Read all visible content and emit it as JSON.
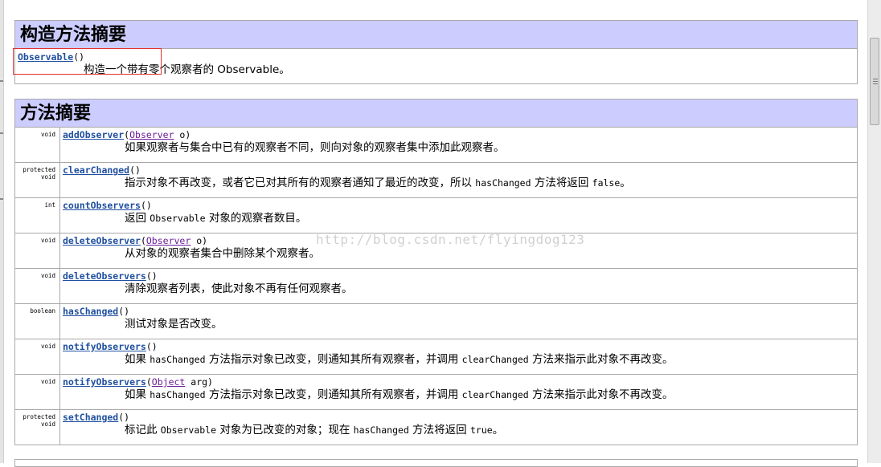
{
  "constructor_summary": {
    "title": "构造方法摘要",
    "constructor": {
      "name": "Observable",
      "params": "()",
      "description": "构造一个带有零个观察者的 Observable。"
    }
  },
  "method_summary": {
    "title": "方法摘要",
    "methods": [
      {
        "modifier_line1": "void",
        "modifier_line2": "",
        "name": "addObserver",
        "sig_open": "(",
        "param_type": "Observer",
        "sig_rest": " o)",
        "desc": [
          {
            "t": "如果观察者与集合中已有的观察者不同，则向对象的观察者集中添加此观察者。"
          }
        ]
      },
      {
        "modifier_line1": "protected",
        "modifier_line2": "void",
        "name": "clearChanged",
        "sig_open": "()",
        "param_type": "",
        "sig_rest": "",
        "desc": [
          {
            "t": "指示对象不再改变，或者它已对其所有的观察者通知了最近的改变，所以 "
          },
          {
            "c": "hasChanged"
          },
          {
            "t": " 方法将返回 "
          },
          {
            "c": "false"
          },
          {
            "t": "。"
          }
        ]
      },
      {
        "modifier_line1": "int",
        "modifier_line2": "",
        "name": "countObservers",
        "sig_open": "()",
        "param_type": "",
        "sig_rest": "",
        "desc": [
          {
            "t": "返回 "
          },
          {
            "c": "Observable"
          },
          {
            "t": " 对象的观察者数目。"
          }
        ]
      },
      {
        "modifier_line1": "void",
        "modifier_line2": "",
        "name": "deleteObserver",
        "sig_open": "(",
        "param_type": "Observer",
        "sig_rest": " o)",
        "desc": [
          {
            "t": "从对象的观察者集合中删除某个观察者。"
          }
        ]
      },
      {
        "modifier_line1": "void",
        "modifier_line2": "",
        "name": "deleteObservers",
        "sig_open": "()",
        "param_type": "",
        "sig_rest": "",
        "desc": [
          {
            "t": "清除观察者列表，使此对象不再有任何观察者。"
          }
        ]
      },
      {
        "modifier_line1": "boolean",
        "modifier_line2": "",
        "name": "hasChanged",
        "sig_open": "()",
        "param_type": "",
        "sig_rest": "",
        "desc": [
          {
            "t": "测试对象是否改变。"
          }
        ]
      },
      {
        "modifier_line1": "void",
        "modifier_line2": "",
        "name": "notifyObservers",
        "sig_open": "()",
        "param_type": "",
        "sig_rest": "",
        "desc": [
          {
            "t": "如果 "
          },
          {
            "c": "hasChanged"
          },
          {
            "t": " 方法指示对象已改变，则通知其所有观察者，并调用 "
          },
          {
            "c": "clearChanged"
          },
          {
            "t": " 方法来指示此对象不再改变。"
          }
        ]
      },
      {
        "modifier_line1": "void",
        "modifier_line2": "",
        "name": "notifyObservers",
        "sig_open": "(",
        "param_type": "Object",
        "sig_rest": " arg)",
        "desc": [
          {
            "t": "如果 "
          },
          {
            "c": "hasChanged"
          },
          {
            "t": " 方法指示对象已改变，则通知其所有观察者，并调用 "
          },
          {
            "c": "clearChanged"
          },
          {
            "t": " 方法来指示此对象不再改变。"
          }
        ]
      },
      {
        "modifier_line1": "protected",
        "modifier_line2": "void",
        "name": "setChanged",
        "sig_open": "()",
        "param_type": "",
        "sig_rest": "",
        "desc": [
          {
            "t": "标记此 "
          },
          {
            "c": "Observable"
          },
          {
            "t": " 对象为已改变的对象；现在 "
          },
          {
            "c": "hasChanged"
          },
          {
            "t": " 方法将返回 "
          },
          {
            "c": "true"
          },
          {
            "t": "。"
          }
        ]
      }
    ]
  },
  "watermark": "http://blog.csdn.net/flyingdog123",
  "colors": {
    "header_bg": "#ccccff",
    "link": "#1f4fa0",
    "type_link": "#6a1b9a",
    "highlight": "#e23030"
  }
}
